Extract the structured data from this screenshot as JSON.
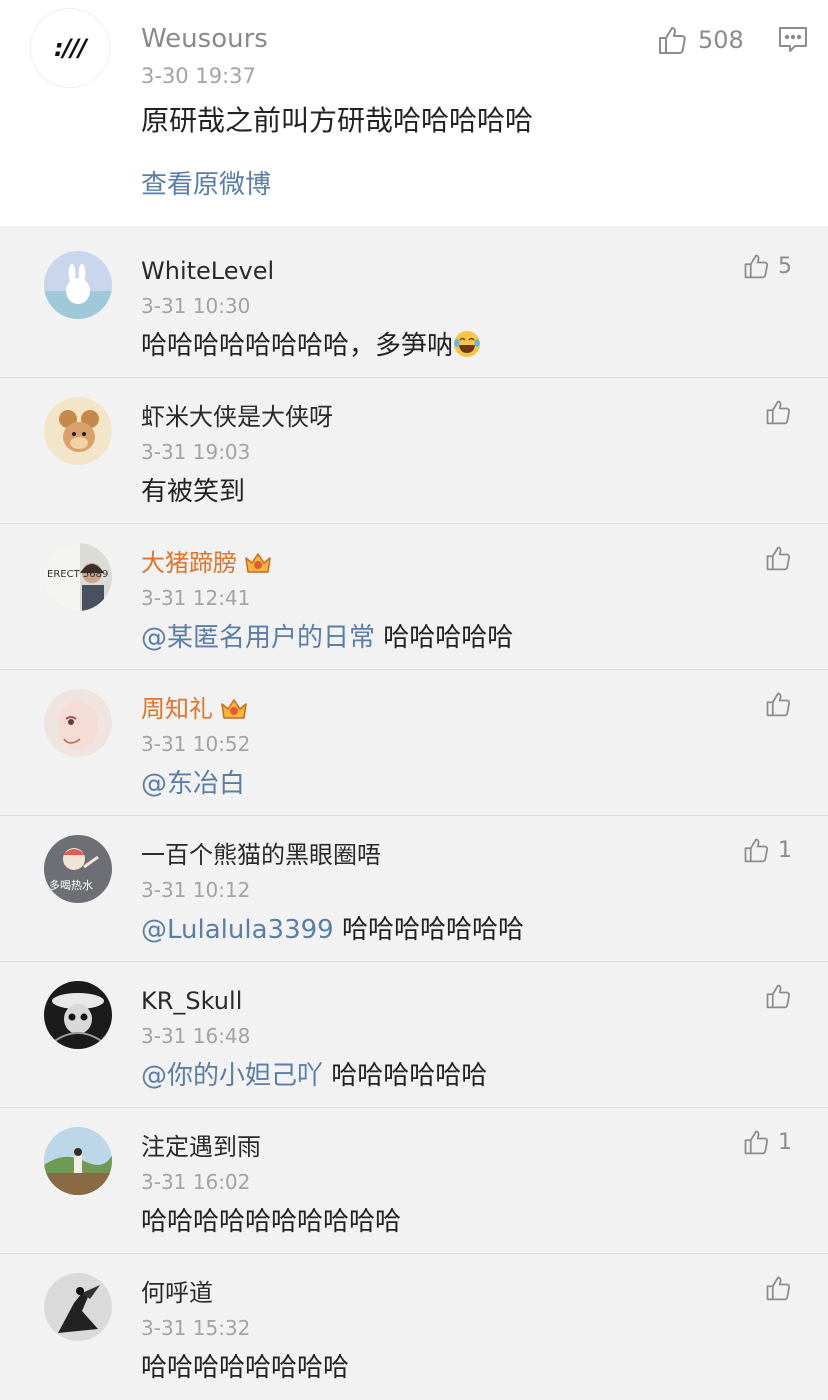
{
  "main_comment": {
    "avatar_text": ":///",
    "username": "Weusours",
    "time": "3-30 19:37",
    "text": "原研哉之前叫方研哉哈哈哈哈哈",
    "likes": "508",
    "view_original": "查看原微博"
  },
  "replies": [
    {
      "username": "WhiteLevel",
      "time": "3-31 10:30",
      "text": "哈哈哈哈哈哈哈哈，多笋呐",
      "emoji": "laughing-tears-emoji",
      "likes": "5",
      "vip": false,
      "avatar": "rabbit-avatar"
    },
    {
      "username": "虾米大侠是大侠呀",
      "time": "3-31 19:03",
      "text": "有被笑到",
      "likes": "",
      "vip": false,
      "avatar": "cartoon-mouse-avatar"
    },
    {
      "username": "大猪蹄膀",
      "time": "3-31 12:41",
      "mention": "@某匿名用户的日常",
      "text": " 哈哈哈哈哈",
      "likes": "",
      "vip": true,
      "avatar": "photo-avatar",
      "avatar_text": "ERECT 5689"
    },
    {
      "username": "周知礼",
      "time": "3-31 10:52",
      "mention": "@东冶白",
      "text": "",
      "likes": "",
      "vip": true,
      "avatar": "drawn-face-avatar"
    },
    {
      "username": "一百个熊猫的黑眼圈唔",
      "time": "3-31 10:12",
      "mention": "@Lulalula3399",
      "text": " 哈哈哈哈哈哈哈",
      "likes": "1",
      "vip": false,
      "avatar": "cartoon-avatar",
      "avatar_text": "多喝热水"
    },
    {
      "username": "KR_Skull",
      "time": "3-31 16:48",
      "mention": "@你的小妲己吖",
      "text": " 哈哈哈哈哈哈",
      "likes": "",
      "vip": false,
      "avatar": "dark-skull-avatar"
    },
    {
      "username": "注定遇到雨",
      "time": "3-31 16:02",
      "text": "哈哈哈哈哈哈哈哈哈哈",
      "likes": "1",
      "vip": false,
      "avatar": "landscape-avatar"
    },
    {
      "username": "何呼道",
      "time": "3-31 15:32",
      "text": "哈哈哈哈哈哈哈哈",
      "likes": "",
      "vip": false,
      "avatar": "silhouette-avatar"
    }
  ],
  "colors": {
    "link": "#5b7ea8",
    "vip_name": "#e0742a",
    "meta": "#a3a3a3",
    "page_bg": "#f2f2f2"
  }
}
